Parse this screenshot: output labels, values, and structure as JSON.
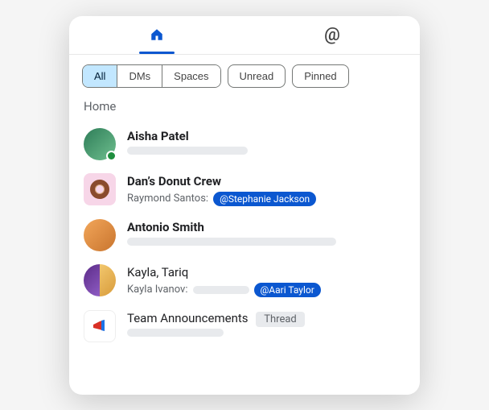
{
  "topnav": {
    "home_icon": "home-icon",
    "mentions_icon": "at-icon"
  },
  "filters": {
    "segmented": [
      "All",
      "DMs",
      "Spaces"
    ],
    "active_index": 0,
    "pills": [
      "Unread",
      "Pinned"
    ]
  },
  "section_title": "Home",
  "conversations": [
    {
      "name": "Aisha Patel",
      "bold": true,
      "avatar_kind": "person-green",
      "presence": "online",
      "preview_type": "placeholder"
    },
    {
      "name": "Dan’s Donut Crew",
      "bold": true,
      "avatar_kind": "donut",
      "sender": "Raymond Santos:",
      "mention": "@Stephanie Jackson"
    },
    {
      "name": "Antonio Smith",
      "bold": true,
      "avatar_kind": "person-orange",
      "preview_type": "placeholder"
    },
    {
      "name": "Kayla, Tariq",
      "bold": false,
      "avatar_kind": "split",
      "sender": "Kayla Ivanov:",
      "preview_type": "placeholder-short",
      "mention": "@Aari Taylor"
    },
    {
      "name": "Team Announcements",
      "bold": false,
      "avatar_kind": "megaphone",
      "badge": "Thread",
      "preview_type": "placeholder"
    }
  ]
}
